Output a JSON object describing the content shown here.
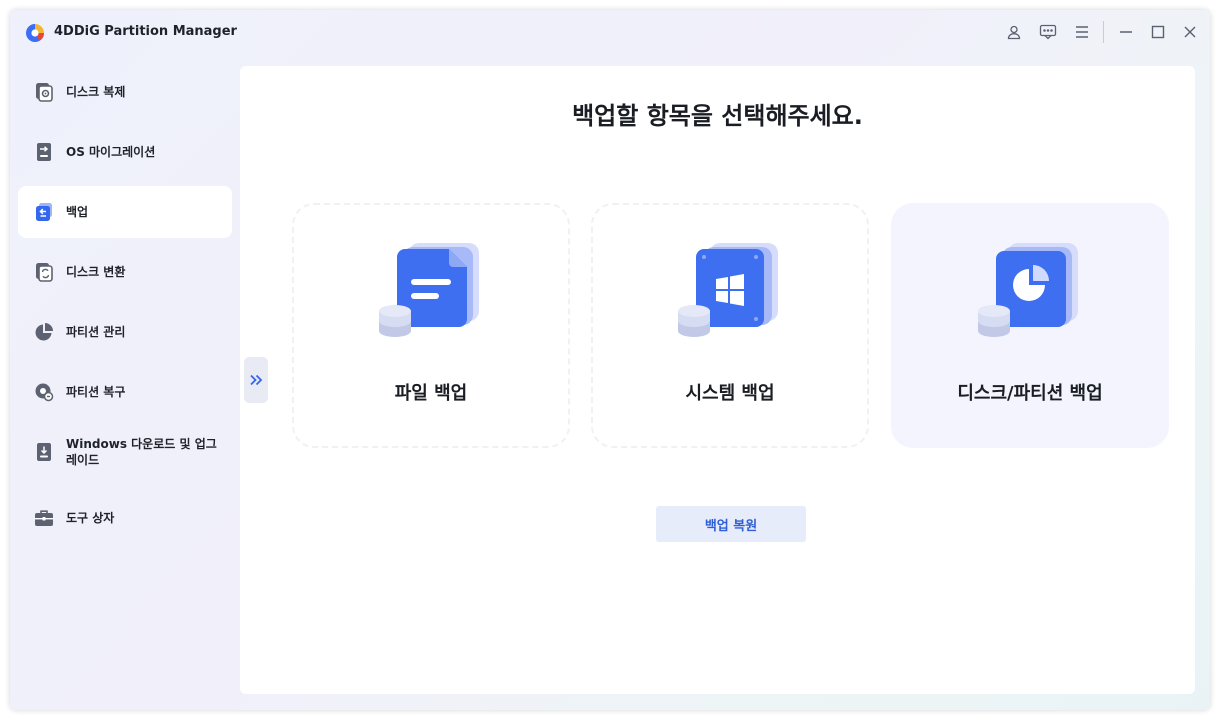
{
  "app": {
    "title": "4DDiG Partition Manager",
    "logo_icon": "4ddig-logo-icon"
  },
  "titlebar": {
    "icons": [
      "user-icon",
      "feedback-icon",
      "menu-icon",
      "minimize-icon",
      "maximize-icon",
      "close-icon"
    ]
  },
  "sidebar": {
    "items": [
      {
        "label": "디스크 복제",
        "icon": "disk-clone-icon",
        "active": false
      },
      {
        "label": "OS 마이그레이션",
        "icon": "os-migration-icon",
        "active": false
      },
      {
        "label": "백업",
        "icon": "backup-icon",
        "active": true
      },
      {
        "label": "디스크 변환",
        "icon": "disk-convert-icon",
        "active": false
      },
      {
        "label": "파티션 관리",
        "icon": "partition-manage-icon",
        "active": false
      },
      {
        "label": "파티션 복구",
        "icon": "partition-recovery-icon",
        "active": false
      },
      {
        "label": "Windows 다운로드 및 업그레이드",
        "icon": "windows-download-icon",
        "active": false
      },
      {
        "label": "도구 상자",
        "icon": "toolbox-icon",
        "active": false
      }
    ]
  },
  "main": {
    "heading": "백업할 항목을 선택해주세요.",
    "cards": [
      {
        "label": "파일 백업",
        "icon": "file-backup-icon",
        "selected": false
      },
      {
        "label": "시스템 백업",
        "icon": "system-backup-icon",
        "selected": false
      },
      {
        "label": "디스크/파티션 백업",
        "icon": "disk-partition-backup-icon",
        "selected": true
      }
    ],
    "restore_button": "백업 복원"
  },
  "colors": {
    "accent": "#2f5fd6",
    "card_blue": "#3d6ff0",
    "card_selected_bg": "#f3f4fe"
  }
}
